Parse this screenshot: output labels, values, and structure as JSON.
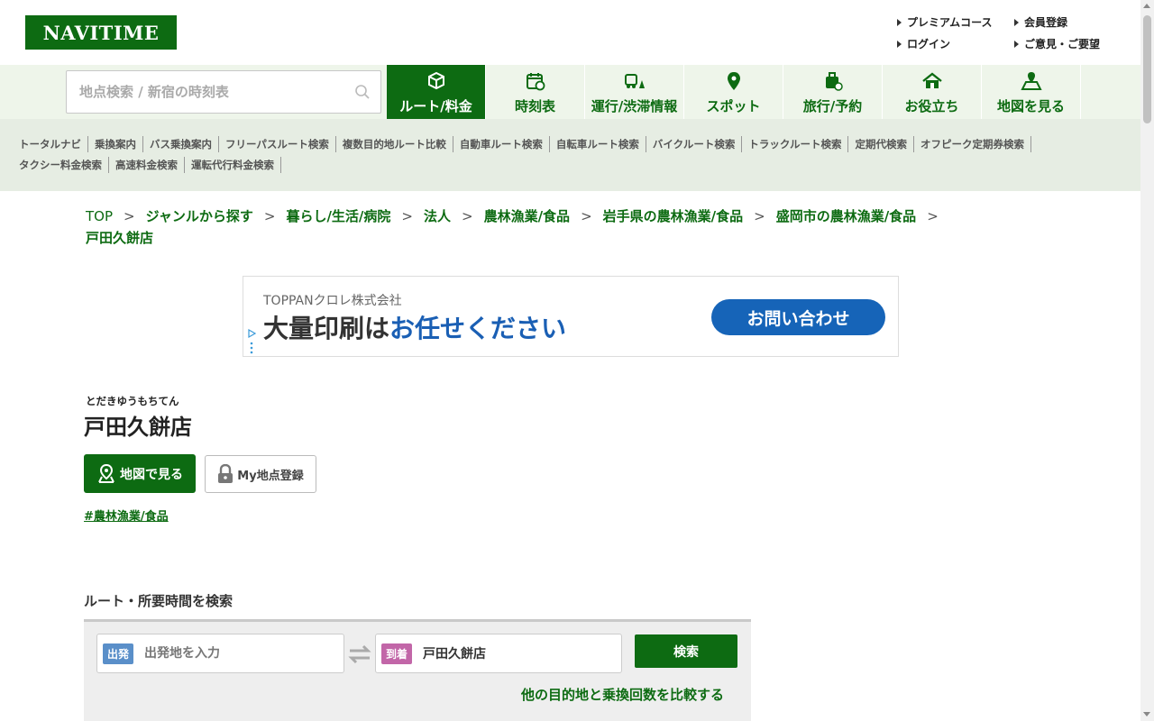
{
  "header": {
    "logo": "NAVITIME",
    "links": [
      "プレミアムコース",
      "会員登録",
      "ログイン",
      "ご意見・ご要望"
    ]
  },
  "nav": {
    "search_placeholder": "地点検索 / 新宿の時刻表",
    "items": [
      {
        "label": "ルート/料金",
        "icon": "route-fare-icon",
        "active": true
      },
      {
        "label": "時刻表",
        "icon": "timetable-icon"
      },
      {
        "label": "運行/渋滞情報",
        "icon": "traffic-info-icon"
      },
      {
        "label": "スポット",
        "icon": "spot-pin-icon"
      },
      {
        "label": "旅行/予約",
        "icon": "travel-suitcase-icon"
      },
      {
        "label": "お役立ち",
        "icon": "house-icon"
      },
      {
        "label": "地図を見る",
        "icon": "map-icon"
      }
    ]
  },
  "subnav": {
    "row1": [
      "トータルナビ",
      "乗換案内",
      "バス乗換案内",
      "フリーパスルート検索",
      "複数目的地ルート比較",
      "自動車ルート検索",
      "自転車ルート検索",
      "バイクルート検索",
      "トラックルート検索",
      "定期代検索",
      "オフピーク定期券検索"
    ],
    "row2": [
      "タクシー料金検索",
      "高速料金検索",
      "運転代行料金検索"
    ]
  },
  "breadcrumb": {
    "items": [
      "TOP",
      "ジャンルから探す",
      "暮らし/生活/病院",
      "法人",
      "農林漁業/食品",
      "岩手県の農林漁業/食品",
      "盛岡市の農林漁業/食品"
    ],
    "current": "戸田久餅店",
    "separator": ">"
  },
  "ad": {
    "company": "TOPPANクロレ株式会社",
    "headline_part1": "大量印刷は",
    "headline_part2": "お任せください",
    "button": "お問い合わせ"
  },
  "spot": {
    "kana": "とだきゆうもちてん",
    "name": "戸田久餅店",
    "map_button": "地図で見る",
    "my_button": "My地点登録",
    "tag": "#農林漁業/食品"
  },
  "route": {
    "heading": "ルート・所要時間を検索",
    "from_badge": "出発",
    "from_placeholder": "出発地を入力",
    "to_badge": "到着",
    "to_value": "戸田久餅店",
    "search_button": "検索",
    "compare_link": "他の目的地と乗換回数を比較する"
  },
  "colors": {
    "brand_green": "#0d6b12",
    "nav_bg": "#eef5ea",
    "subnav_bg": "#e6ede3",
    "ad_blue": "#1664b8"
  }
}
